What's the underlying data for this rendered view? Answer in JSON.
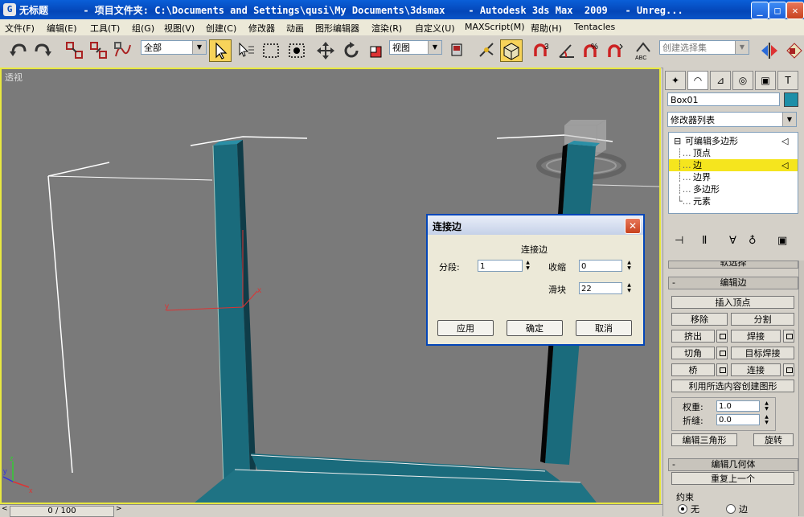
{
  "window": {
    "app_icon": "G",
    "title": "无标题      - 项目文件夹: C:\\Documents and Settings\\qusi\\My Documents\\3dsmax    - Autodesk 3ds Max  2009   - Unreg...",
    "minimize": "_",
    "maximize": "□",
    "close": "✕"
  },
  "menu": [
    "文件(F)",
    "编辑(E)",
    "工具(T)",
    "组(G)",
    "视图(V)",
    "创建(C)",
    "修改器",
    "动画",
    "图形编辑器",
    "渲染(R)",
    "自定义(U)",
    "MAXScript(M)",
    "帮助(H)",
    "Tentacles"
  ],
  "toolbar": {
    "selection_filter": "全部",
    "reference_coord": "视图",
    "named_selection": "创建选择集",
    "snap_3": "3",
    "abc_icon": "ABC"
  },
  "viewport": {
    "label": "透视",
    "gizmo_x": "x",
    "gizmo_y": "y",
    "axis_x": "x",
    "axis_y": "y",
    "axis_z": "z"
  },
  "status": {
    "frame_counter": "0 / 100"
  },
  "command_panel": {
    "object_name": "Box01",
    "object_color": "#1e8fa8",
    "modifier_list": "修改器列表",
    "stack": {
      "root": "可编辑多边形",
      "children": [
        "顶点",
        "边",
        "边界",
        "多边形",
        "元素"
      ],
      "selected_index": 1
    },
    "rollout_top": "软选择",
    "edit_edges": {
      "title": "编辑边",
      "insert_vertex": "插入顶点",
      "remove": "移除",
      "split": "分割",
      "extrude": "挤出",
      "weld": "焊接",
      "chamfer": "切角",
      "target_weld": "目标焊接",
      "bridge": "桥",
      "connect": "连接",
      "create_shape": "利用所选内容创建图形",
      "weight_label": "权重:",
      "weight_value": "1.0",
      "crease_label": "折缝:",
      "crease_value": "0.0",
      "edit_tri": "编辑三角形",
      "turn": "旋转"
    },
    "edit_geometry": {
      "title": "编辑几何体",
      "repeat_last": "重复上一个",
      "constraints_label": "约束",
      "opt_none": "无",
      "opt_edge": "边"
    }
  },
  "dialog": {
    "title": "连接边",
    "group_label": "连接边",
    "segments_label": "分段:",
    "segments_value": "1",
    "pinch_label": "收缩",
    "pinch_value": "0",
    "slide_label": "滑块",
    "slide_value": "22",
    "apply": "应用",
    "ok": "确定",
    "cancel": "取消",
    "close": "✕"
  }
}
